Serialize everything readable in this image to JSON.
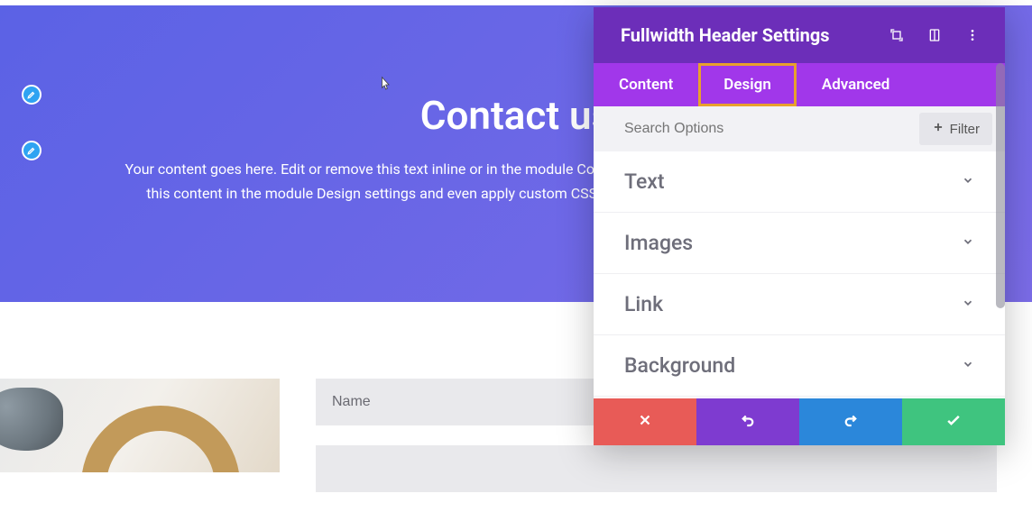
{
  "hero": {
    "title": "Contact us",
    "body": "Your content goes here. Edit or remove this text inline or in the module Content settings. You can also style every aspect of this content in the module Design settings and even apply custom CSS to this text in the module Advanced settings."
  },
  "form": {
    "name_placeholder": "Name"
  },
  "panel": {
    "title": "Fullwidth Header Settings",
    "tabs": {
      "content": "Content",
      "design": "Design",
      "advanced": "Advanced",
      "active": "design"
    },
    "search": {
      "placeholder": "Search Options",
      "filter_label": "Filter"
    },
    "sections": [
      {
        "label": "Text"
      },
      {
        "label": "Images"
      },
      {
        "label": "Link"
      },
      {
        "label": "Background"
      }
    ]
  }
}
